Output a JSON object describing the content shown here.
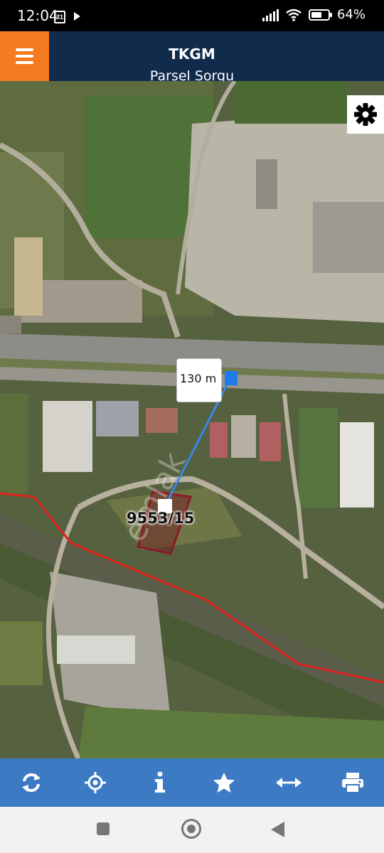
{
  "status_bar": {
    "time": "12:04",
    "calendar_day": "31",
    "battery_percent_text": "64%",
    "battery_level": 0.64
  },
  "header": {
    "title": "TKGM",
    "subtitle": "Parsel Sorgu"
  },
  "map": {
    "distance_label": "130 m",
    "parcel_label": "9553/15",
    "watermark": "emlak",
    "colors": {
      "measure_line": "#3a86e8",
      "parcel_outline": "#8b1a2a",
      "boundary_line": "#e0231c"
    }
  },
  "toolbar": {
    "items": [
      {
        "icon": "refresh-icon"
      },
      {
        "icon": "crosshair-icon"
      },
      {
        "icon": "info-icon"
      },
      {
        "icon": "star-icon"
      },
      {
        "icon": "measure-icon"
      },
      {
        "icon": "print-icon"
      }
    ],
    "color": "#3c7bc4"
  },
  "header_colors": {
    "background": "#112b4d",
    "menu_button": "#f47b20"
  }
}
